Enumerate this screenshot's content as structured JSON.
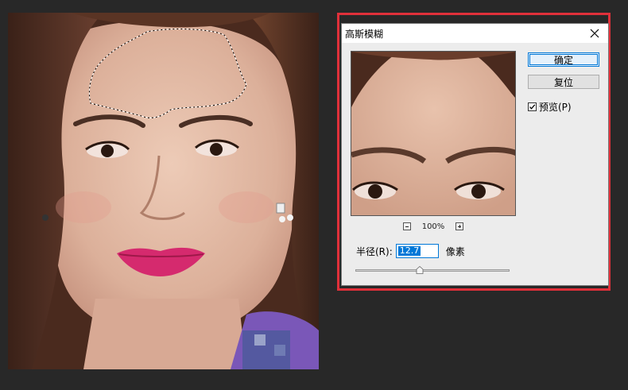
{
  "dialog": {
    "title": "高斯模糊",
    "ok_label": "确定",
    "reset_label": "复位",
    "preview_label": "预览(P)",
    "preview_checked": true,
    "zoom_label": "100%",
    "radius_label": "半径(R):",
    "radius_value": "12.7",
    "radius_unit": "像素",
    "slider_level": 0.42
  },
  "icons": {
    "close": "close-icon",
    "zoom_out": "zoom-out-icon",
    "zoom_in": "zoom-in-icon",
    "check": "checkmark-icon"
  },
  "colors": {
    "highlight": "#e0303a",
    "accent": "#0078d7",
    "lipstick": "#d52a6e"
  }
}
